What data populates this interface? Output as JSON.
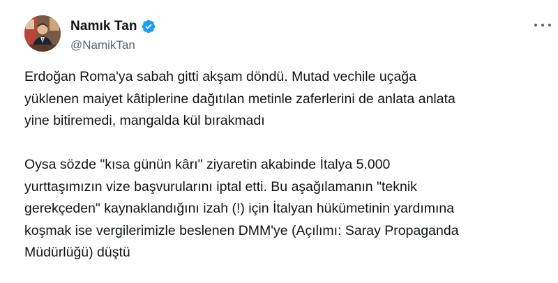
{
  "author": {
    "display_name": "Namık Tan",
    "handle": "@NamikTan"
  },
  "icons": {
    "verified": "verified-badge-icon",
    "more": "more-options-icon"
  },
  "colors": {
    "verified_blue": "#1d9bf0",
    "text_primary": "#0f1419",
    "text_secondary": "#536471"
  },
  "tweet": {
    "paragraphs": [
      {
        "lines": [
          "Erdoğan Roma'ya sabah gitti akşam döndü. Mutad vechile  uçağa",
          "yüklenen maiyet kâtiplerine dağıtılan metinle zaferlerini de anlata anlata",
          "yine bitiremedi, mangalda kül bırakmadı"
        ]
      },
      {
        "lines": [
          "Oysa sözde \"kısa günün kârı\" ziyaretin akabinde İtalya 5.000",
          "yurttaşımızın vize başvurularını iptal etti. Bu aşağılamanın \"teknik",
          "gerekçeden\" kaynaklandığını izah (!) için İtalyan hükümetinin yardımına",
          "koşmak ise vergilerimizle beslenen DMM'ye (Açılımı: Saray Propaganda",
          "Müdürlüğü) düştü"
        ]
      }
    ]
  }
}
